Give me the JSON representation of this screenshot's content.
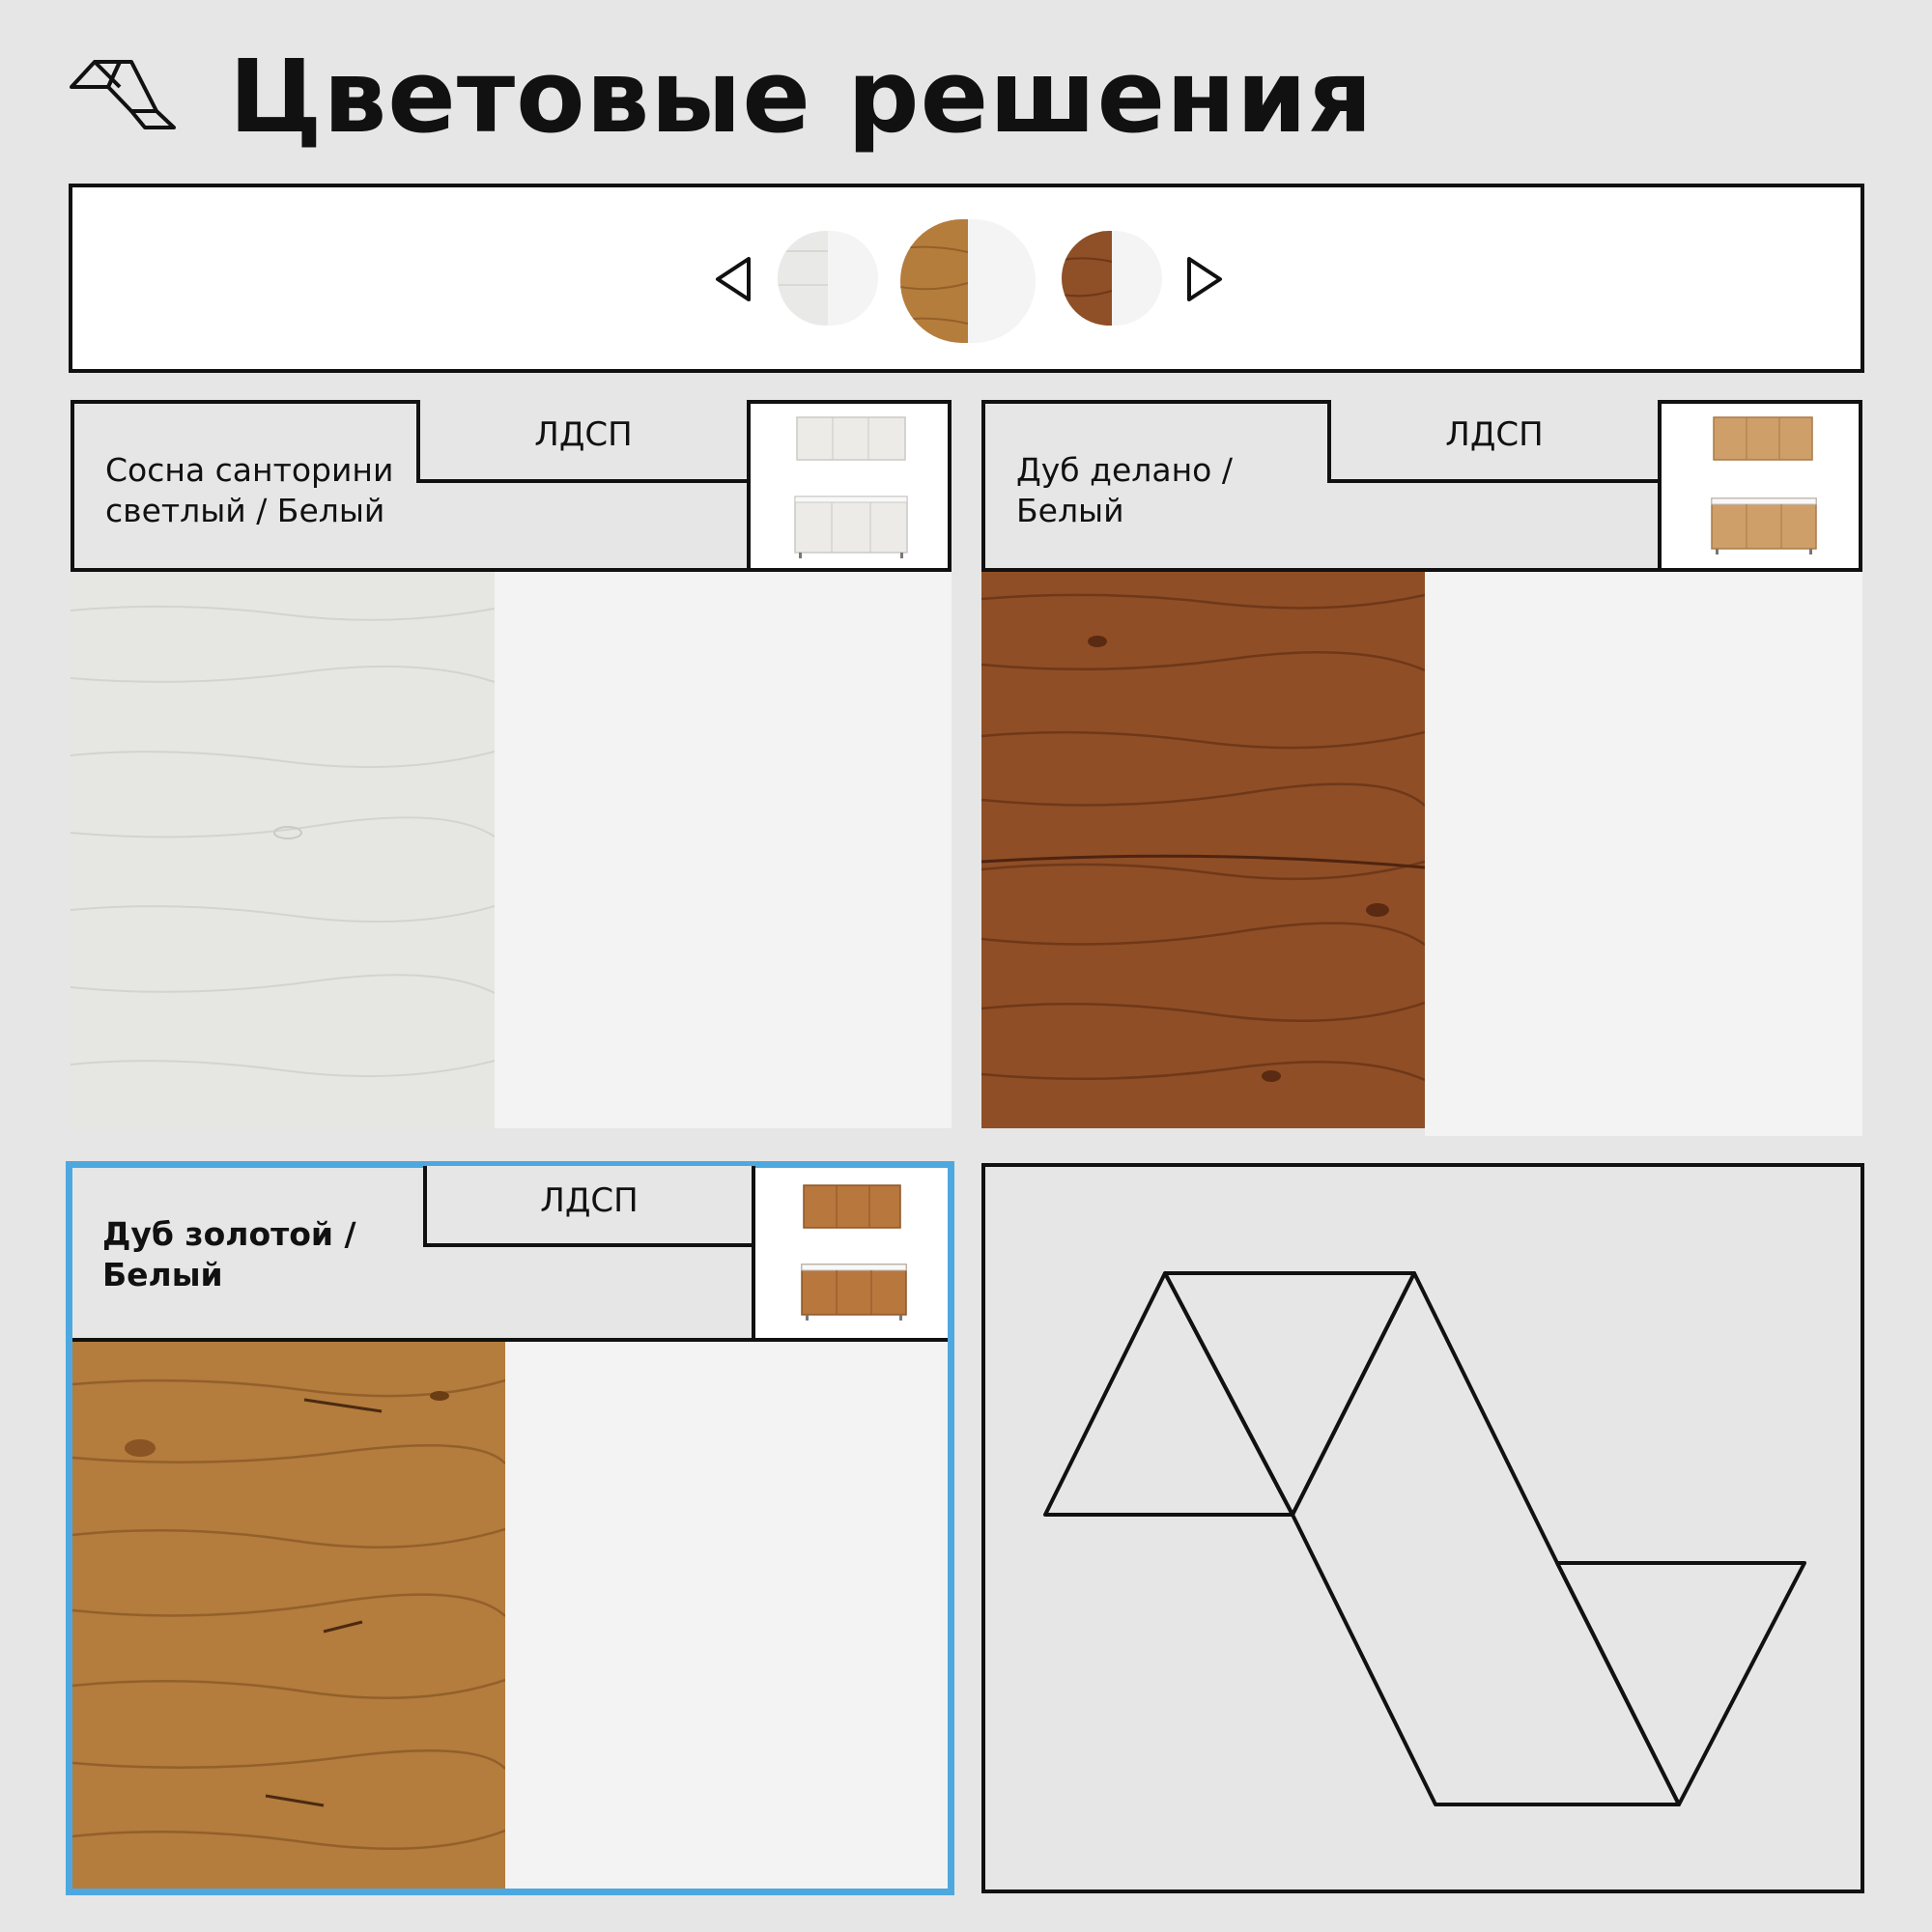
{
  "page": {
    "title": "Цветовые решения"
  },
  "selector": {
    "swatches": [
      {
        "name": "Сосна санторини светлый / Белый",
        "left": "#e9e9e7",
        "right": "#f4f4f4"
      },
      {
        "name": "Дуб золотой / Белый",
        "left": "#b57d3c",
        "right": "#f4f4f4",
        "selected": true
      },
      {
        "name": "Дуб делано / Белый",
        "left": "#8f4f27",
        "right": "#f4f4f4"
      }
    ]
  },
  "cards": [
    {
      "name_line1": "Сосна санторини",
      "name_line2": "светлый / Белый",
      "material": "ЛДСП",
      "wood": "#e5e5e2",
      "grain": "#cfcfcb"
    },
    {
      "name_line1": "Дуб делано /",
      "name_line2": "Белый",
      "material": "ЛДСП",
      "wood": "#8f4e26",
      "grain": "#6e3818"
    },
    {
      "name_line1": "Дуб золотой /",
      "name_line2": "Белый",
      "material": "ЛДСП",
      "wood": "#b47c3d",
      "grain": "#8d5a25",
      "selected": true
    }
  ],
  "colors": {
    "accent": "#4ea8e0",
    "ink": "#111111",
    "bg": "#e6e6e6"
  }
}
